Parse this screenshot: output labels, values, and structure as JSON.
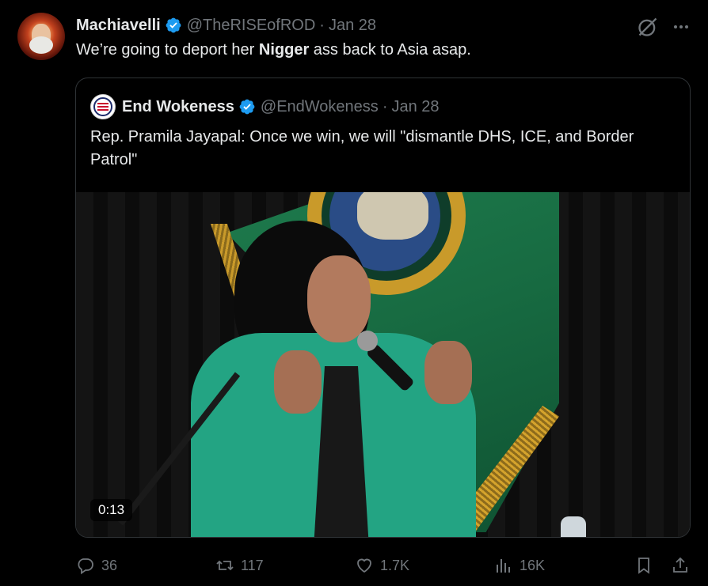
{
  "tweet": {
    "author_name": "Machiavelli",
    "author_handle": "@TheRISEofROD",
    "date_sep": "·",
    "date": "Jan 28",
    "text_before": "We’re going to deport her ",
    "text_bold": "Nigger",
    "text_after": " ass back to Asia asap."
  },
  "quote": {
    "author_name": "End Wokeness",
    "author_handle": "@EndWokeness",
    "date_sep": "·",
    "date": "Jan 28",
    "text": "Rep. Pramila Jayapal: Once we win, we will \"dismantle DHS, ICE, and Border Patrol\"",
    "video_timestamp": "0:13"
  },
  "actions": {
    "replies": "36",
    "reposts": "117",
    "likes": "1.7K",
    "views": "16K"
  },
  "icons": {
    "verified": "verified-badge-icon",
    "grok": "grok-icon",
    "more": "more-icon",
    "reply": "reply-icon",
    "repost": "repost-icon",
    "like": "heart-icon",
    "views": "views-icon",
    "bookmark": "bookmark-icon",
    "share": "share-icon"
  },
  "colors": {
    "background": "#000000",
    "text": "#e7e9ea",
    "muted": "#71767b",
    "verified": "#1d9bf0",
    "border": "#2f3336"
  }
}
